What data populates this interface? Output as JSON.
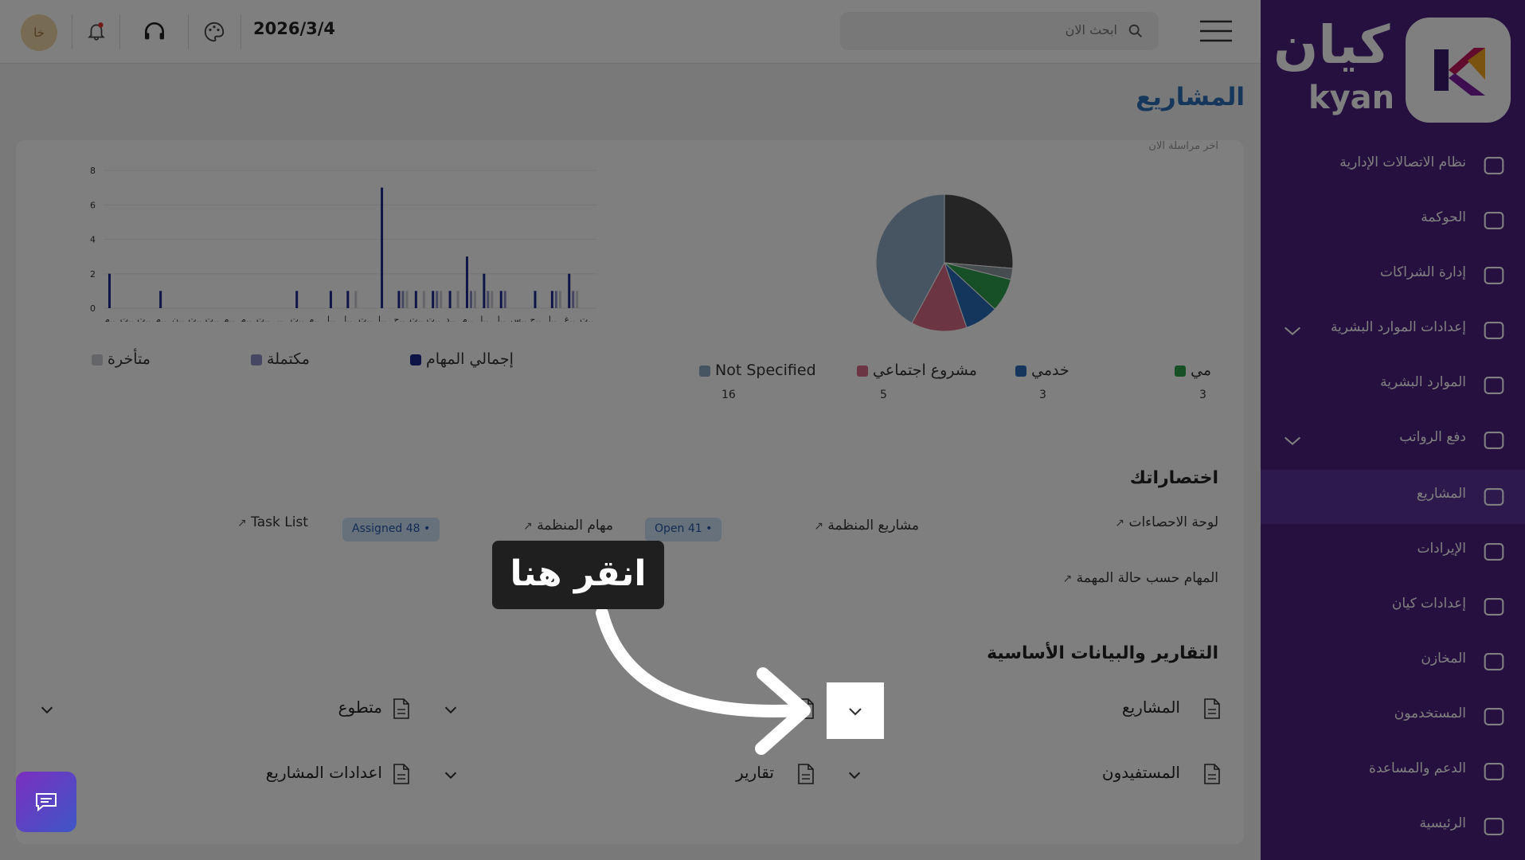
{
  "topbar": {
    "date": "2026/3/4",
    "search_placeholder": "ابحث الان",
    "avatar_initials": "خا"
  },
  "sidebar": {
    "logo_arabic": "كيان",
    "logo_latin": "kyan",
    "items": [
      {
        "label": "نظام الاتصالات الإدارية",
        "icon": "arrows-swap-icon"
      },
      {
        "label": "الحوكمة",
        "icon": "building-icon"
      },
      {
        "label": "إدارة الشراكات",
        "icon": "document-icon"
      },
      {
        "label": "إعدادات الموارد البشرية",
        "icon": "briefcase-icon"
      },
      {
        "label": "الموارد البشرية",
        "icon": "users-icon"
      },
      {
        "label": "دفع الرواتب",
        "icon": "payroll-icon"
      },
      {
        "label": "المشاريع",
        "icon": "folder-icon"
      },
      {
        "label": "الإيرادات",
        "icon": "card-icon"
      },
      {
        "label": "إعدادات كيان",
        "icon": "settings-toggle-icon"
      },
      {
        "label": "المخازن",
        "icon": "box-icon"
      },
      {
        "label": "المستخدمون",
        "icon": "user-group-icon"
      },
      {
        "label": "الدعم والمساعدة",
        "icon": "headset-icon"
      },
      {
        "label": "الرئيسية",
        "icon": "tools-icon"
      }
    ]
  },
  "page": {
    "title": "المشاريع",
    "faded_text": "اخر مراسلة الان"
  },
  "pie_legend": [
    {
      "label": "Not Specified",
      "count": "16",
      "color": "#8faac4"
    },
    {
      "label": "مشروع اجتماعي",
      "count": "5",
      "color": "#d96b86"
    },
    {
      "label": "خدمي",
      "count": "3",
      "color": "#2a6cb8"
    },
    {
      "label": "مي",
      "count": "3",
      "color": "#2e9e4f"
    }
  ],
  "bar_legend": [
    {
      "label": "إجمالي المهام",
      "color": "#1c2a8c"
    },
    {
      "label": "مكتملة",
      "color": "#8a8fc7"
    },
    {
      "label": "متأخرة",
      "color": "#c8ccd3"
    }
  ],
  "chart_data": [
    {
      "type": "pie",
      "categories": [
        "Not Specified",
        "مشروع اجتماعي",
        "خدمي",
        "مي",
        "slice-gray",
        "slice-dark"
      ],
      "values": [
        16,
        5,
        3,
        3,
        1,
        10
      ],
      "colors": [
        "#8faac4",
        "#d96b86",
        "#2a6cb8",
        "#2e9e4f",
        "#8d9aa3",
        "#4a4a4a"
      ]
    },
    {
      "type": "bar",
      "ylim": [
        0,
        8
      ],
      "yticks": [
        "0",
        "2",
        "4",
        "6",
        "8"
      ],
      "categories": [
        "م..",
        "ت..",
        "ت..",
        "م..",
        "ن..",
        "ت..",
        "ت..",
        "م..",
        "م..",
        "ت..",
        "..",
        "ت..",
        "م..",
        "ا..",
        "ا..",
        "ت..",
        "ا..",
        "ج..",
        "ت..",
        "ت..",
        "د..",
        "م..",
        "ا..",
        "ا..",
        "س..",
        "ج..",
        "ا..",
        "غ..",
        "ت.."
      ],
      "series": [
        {
          "name": "إجمالي المهام",
          "values": [
            2,
            0,
            0,
            1,
            0,
            0,
            0,
            0,
            0,
            0,
            0,
            1,
            0,
            1,
            1,
            0,
            7,
            1,
            1,
            1,
            1,
            3,
            2,
            1,
            0,
            1,
            1,
            2,
            0
          ]
        },
        {
          "name": "مكتملة",
          "values": [
            0,
            0,
            0,
            0,
            0,
            0,
            0,
            0,
            0,
            0,
            0,
            0,
            0,
            0,
            0,
            0,
            0,
            1,
            0,
            1,
            0,
            1,
            1,
            1,
            0,
            0,
            1,
            1,
            0
          ]
        },
        {
          "name": "متأخرة",
          "values": [
            0,
            0,
            0,
            0,
            0,
            0,
            0,
            0,
            0,
            0,
            0,
            0,
            0,
            0,
            1,
            0,
            0,
            1,
            1,
            1,
            1,
            1,
            1,
            0,
            0,
            0,
            1,
            1,
            0
          ]
        }
      ]
    }
  ],
  "shortcuts": {
    "title": "اختصاراتك",
    "items": {
      "dashboard": "لوحة الاحصاءات",
      "org_projects": "مشاريع المنظمة",
      "org_tasks": "مهام المنظمة",
      "task_list": "Task List",
      "tasks_by_status": "المهام حسب حالة المهمة"
    },
    "badges": {
      "open": "Open 41",
      "assigned": "Assigned 48"
    }
  },
  "reports": {
    "title": "التقارير والبيانات الأساسية",
    "items": {
      "projects": "المشاريع",
      "volunteer": "متطوع",
      "beneficiaries": "المستفيدون",
      "reports": "تقارير",
      "project_settings": "اعدادات المشاريع"
    }
  },
  "tooltip": {
    "text": "انقر هنا"
  }
}
